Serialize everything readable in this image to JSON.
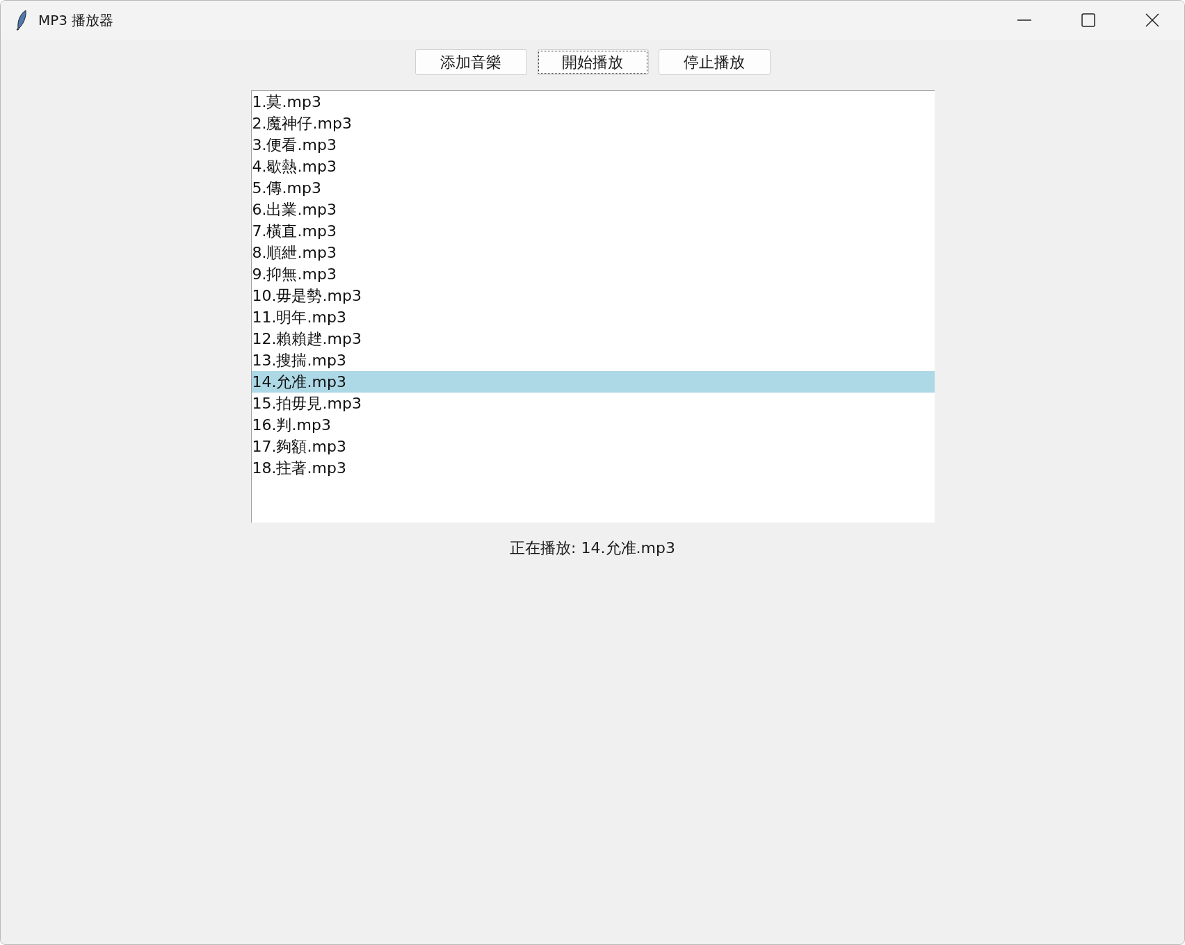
{
  "window": {
    "title": "MP3 播放器"
  },
  "buttons": [
    {
      "label": "添加音樂",
      "focused": false
    },
    {
      "label": "開始播放",
      "focused": true
    },
    {
      "label": "停止播放",
      "focused": false
    }
  ],
  "playlist": [
    {
      "label": "1.莫.mp3",
      "selected": false
    },
    {
      "label": "2.魔神仔.mp3",
      "selected": false
    },
    {
      "label": "3.便看.mp3",
      "selected": false
    },
    {
      "label": "4.歇熱.mp3",
      "selected": false
    },
    {
      "label": "5.傳.mp3",
      "selected": false
    },
    {
      "label": "6.出業.mp3",
      "selected": false
    },
    {
      "label": "7.橫直.mp3",
      "selected": false
    },
    {
      "label": "8.順紲.mp3",
      "selected": false
    },
    {
      "label": "9.抑無.mp3",
      "selected": false
    },
    {
      "label": "10.毋是勢.mp3",
      "selected": false
    },
    {
      "label": "11.明年.mp3",
      "selected": false
    },
    {
      "label": "12.賴賴趖.mp3",
      "selected": false
    },
    {
      "label": "13.搜揣.mp3",
      "selected": false
    },
    {
      "label": "14.允准.mp3",
      "selected": true
    },
    {
      "label": "15.拍毋見.mp3",
      "selected": false
    },
    {
      "label": "16.判.mp3",
      "selected": false
    },
    {
      "label": "17.夠額.mp3",
      "selected": false
    },
    {
      "label": "18.拄著.mp3",
      "selected": false
    }
  ],
  "status": "正在播放: 14.允准.mp3"
}
